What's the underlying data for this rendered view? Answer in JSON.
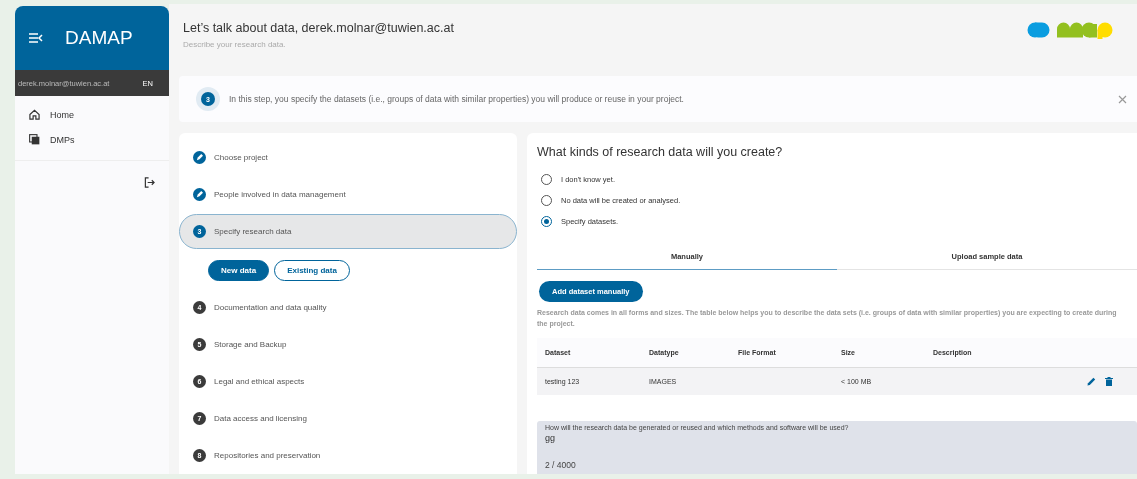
{
  "sidebar": {
    "app_title": "DAMAP",
    "user": "derek.molnar@tuwien.ac.at",
    "language": "EN",
    "items": [
      {
        "label": "Home",
        "selected": false
      },
      {
        "label": "DMPs",
        "selected": false
      }
    ]
  },
  "header": {
    "title": "Let’s talk about data, derek.molnar@tuwien.ac.at",
    "subtitle": "Describe your research data."
  },
  "info_banner": {
    "step": "3",
    "text": "In this step, you specify the datasets (i.e., groups of data with similar properties) you will produce or reuse in your project."
  },
  "steps": [
    {
      "label": "Choose project",
      "kind": "done",
      "selected": false
    },
    {
      "label": "People involved in data management",
      "kind": "done",
      "selected": false
    },
    {
      "number": "3",
      "label": "Specify research data",
      "kind": "current",
      "selected": true,
      "sub_buttons": [
        {
          "label": "New data",
          "selected": true
        },
        {
          "label": "Existing data",
          "selected": false
        }
      ]
    },
    {
      "number": "4",
      "label": "Documentation and data quality",
      "kind": "todo",
      "selected": false
    },
    {
      "number": "5",
      "label": "Storage and Backup",
      "kind": "todo",
      "selected": false
    },
    {
      "number": "6",
      "label": "Legal and ethical aspects",
      "kind": "todo",
      "selected": false
    },
    {
      "number": "7",
      "label": "Data access and licensing",
      "kind": "todo",
      "selected": false
    },
    {
      "number": "8",
      "label": "Repositories and preservation",
      "kind": "todo",
      "selected": false
    }
  ],
  "content": {
    "question": "What kinds of research data will you create?",
    "options": [
      {
        "label": "I don't know yet.",
        "selected": false
      },
      {
        "label": "No data will be created or analysed.",
        "selected": false
      },
      {
        "label": "Specify datasets.",
        "selected": true
      }
    ],
    "tabs": [
      {
        "label": "Manually",
        "selected": true
      },
      {
        "label": "Upload sample data",
        "selected": false
      }
    ],
    "add_button": "Add dataset manually",
    "description": "Research data comes in all forms and sizes. The table below helps you to describe the data sets (i.e. groups of data with similar properties) you are expecting to create during the project.",
    "table": {
      "columns": [
        "Dataset",
        "Datatype",
        "File Format",
        "Size",
        "Description"
      ],
      "rows": [
        [
          "testing 123",
          "IMAGES",
          "",
          "< 100 MB",
          ""
        ]
      ]
    },
    "textarea": {
      "label": "How will the research data be generated or reused and which methods and software will be used?",
      "value": "gg",
      "counter": "2 / 4000"
    }
  }
}
